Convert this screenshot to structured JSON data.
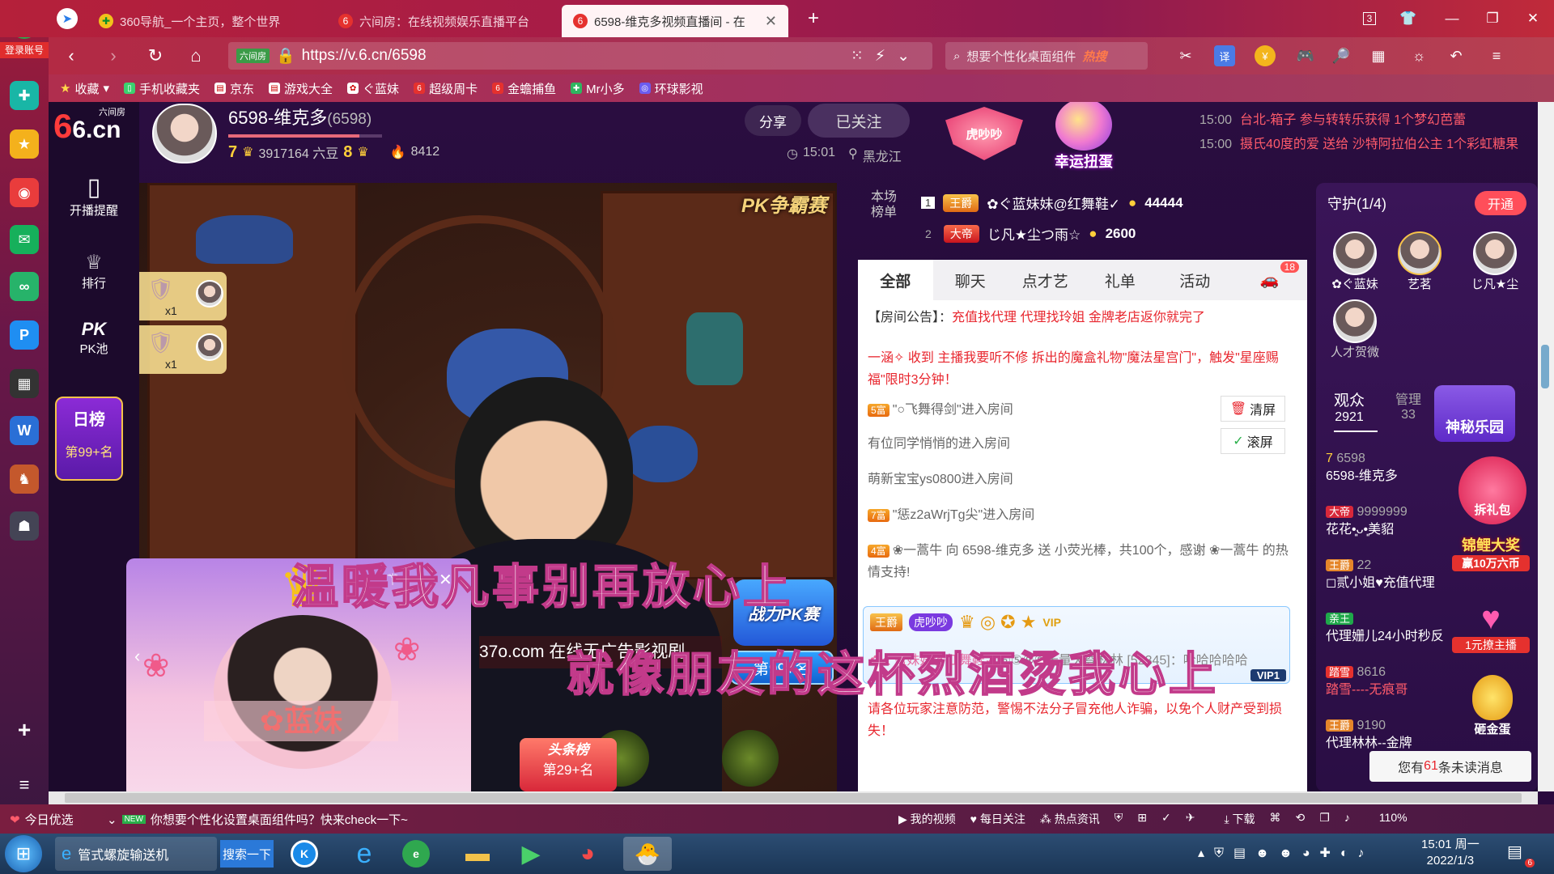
{
  "browser": {
    "tabs": [
      {
        "label": "360导航_一个主页，整个世界"
      },
      {
        "label": "六间房：在线视频娱乐直播平台"
      },
      {
        "label": "6598-维克多视频直播间 - 在"
      }
    ],
    "tab_count": "3",
    "url_prefix": "六间房",
    "url": "https://v.6.cn/6598",
    "search_placeholder": "想要个性化桌面组件",
    "search_hot": "热搜",
    "login": "登录账号",
    "bookmarks": [
      {
        "label": "收藏"
      },
      {
        "label": "手机收藏夹"
      },
      {
        "label": "京东"
      },
      {
        "label": "游戏大全"
      },
      {
        "label": "ぐ蓝妹"
      },
      {
        "label": "超级周卡"
      },
      {
        "label": "金蟾捕鱼"
      },
      {
        "label": "Mr小多"
      },
      {
        "label": "环球影视"
      }
    ]
  },
  "site": {
    "logo": "6.cn",
    "logo_sub": "六间房",
    "nav": [
      {
        "label": "开播提醒"
      },
      {
        "label": "排行"
      },
      {
        "label": "PK池"
      }
    ],
    "daily_rank": {
      "title": "日榜",
      "value": "第99+名"
    }
  },
  "anchor": {
    "name": "6598-维克多",
    "room_id": "(6598)",
    "level_left": "7",
    "beans": "3917164 六豆",
    "level_right": "8",
    "hot": "8412",
    "time": "15:01",
    "location": "黑龙江",
    "share": "分享",
    "follow": "已关注"
  },
  "promo": {
    "badge": "虎吵吵",
    "lucky": "幸运扭蛋"
  },
  "notices": [
    {
      "time": "15:00",
      "text": "台北-箱子 参与转转乐获得 1个梦幻芭蕾"
    },
    {
      "time": "15:00",
      "text": "摄氏40度的爱 送给 沙特阿拉伯公主 1个彩虹糖果"
    }
  ],
  "board": {
    "title": "本场榜单",
    "rows": [
      {
        "rank": "1",
        "title": "王爵",
        "name": "✿ぐ蓝妹妹@红舞鞋✓",
        "coins": "44444"
      },
      {
        "rank": "2",
        "title": "大帝",
        "name": "じ凡★尘つ雨☆",
        "coins": "2600"
      }
    ]
  },
  "video": {
    "pk_badge": "PK争霸赛",
    "pk_battle": "战力PK赛",
    "pk_rank": "第99+名",
    "marquee": "37o.com 在线无广告影视剧",
    "gift_count": [
      "x1",
      "x1"
    ],
    "subtitle_1": "温暖我凡事别再放心上",
    "subtitle_2": "就像朋友的这杯烈酒烫我心上",
    "mini_name": "蓝妹",
    "mini_rank_title": "头条榜",
    "mini_rank": "第29+名"
  },
  "chat": {
    "tabs": [
      {
        "label": "全部"
      },
      {
        "label": "聊天"
      },
      {
        "label": "点才艺"
      },
      {
        "label": "礼单"
      },
      {
        "label": "活动"
      }
    ],
    "car_badge": "18",
    "announcement_label": "【房间公告】：",
    "announcement": "充值找代理 代理找玲姐 金牌老店返你就完了",
    "system": "一涵✧ 收到 主播我要听不修 拆出的魔盒礼物\"魔法星宫门\"，触发\"星座赐福\"限时3分钟！",
    "clear": "清屏",
    "scroll": "滚屏",
    "messages": [
      {
        "level": "5富",
        "text": "\"○飞舞得剑\"进入房间"
      },
      {
        "level": "",
        "text": "有位同学悄悄的进入房间"
      },
      {
        "level": "",
        "text": "萌新宝宝ys0800进入房间"
      },
      {
        "level": "7富",
        "text": "\"惩z2aWrjTg尖\"进入房间"
      },
      {
        "level": "4富",
        "text": "❀一蒿牛 向 6598-维克多 送 小荧光棒，共100个，感谢 ❀一蒿牛 的热情支持!"
      }
    ],
    "vip_msg": {
      "title": "王爵",
      "badge": "虎吵吵",
      "name": "✿ぐ蓝妹妹@红舞鞋✓",
      "text": "⑥⑤⑨⑧无量天尊林林 [52345]：哈哈哈哈哈",
      "vip": "VIP1"
    },
    "warning": "请各位玩家注意防范，警惕不法分子冒充他人诈骗，以免个人财产受到损失！"
  },
  "guard": {
    "title": "守护(1/4)",
    "open": "开通",
    "members": [
      {
        "name": "✿ぐ蓝妹"
      },
      {
        "name": "艺茗"
      },
      {
        "name": "じ凡★尘"
      },
      {
        "name": "人才贺微"
      }
    ],
    "audience_label": "观众",
    "audience": "2921",
    "admin_label": "管理",
    "admin": "33",
    "mystery": "神秘乐园",
    "list": [
      {
        "title": "7",
        "name": "6598-维克多",
        "num": "6598"
      },
      {
        "title": "大帝",
        "name": "花花•͈ᴗ•͈美貂",
        "num": "9999999"
      },
      {
        "title": "王爵",
        "name": "◻贰小姐♥充值代理",
        "num": "22"
      },
      {
        "title": "亲王",
        "name": "代理姗儿24小时秒反",
        "num": ""
      },
      {
        "title": "踏雪",
        "name": "踏雪----无痕哥",
        "num": "8616"
      },
      {
        "title": "王爵",
        "name": "代理林林--金牌",
        "num": "9190"
      }
    ],
    "gift_pack": "拆礼包",
    "koi": "锦鲤大奖",
    "koi_sub": "赢10万六币",
    "one_yuan": "1元撩主播",
    "egg": "砸金蛋",
    "unread_pre": "您有",
    "unread": "61",
    "unread_post": "条未读消息"
  },
  "status": {
    "left": "今日优选",
    "tip": "你想要个性化设置桌面组件吗？快来check一下~",
    "items": [
      {
        "label": "我的视频"
      },
      {
        "label": "每日关注"
      },
      {
        "label": "热点资讯"
      },
      {
        "label": "下载"
      }
    ],
    "zoom": "110%"
  },
  "taskbar": {
    "app1": "管式螺旋输送机",
    "search": "搜索一下",
    "time": "15:01 周一",
    "date": "2022/1/3",
    "notif": "6"
  }
}
